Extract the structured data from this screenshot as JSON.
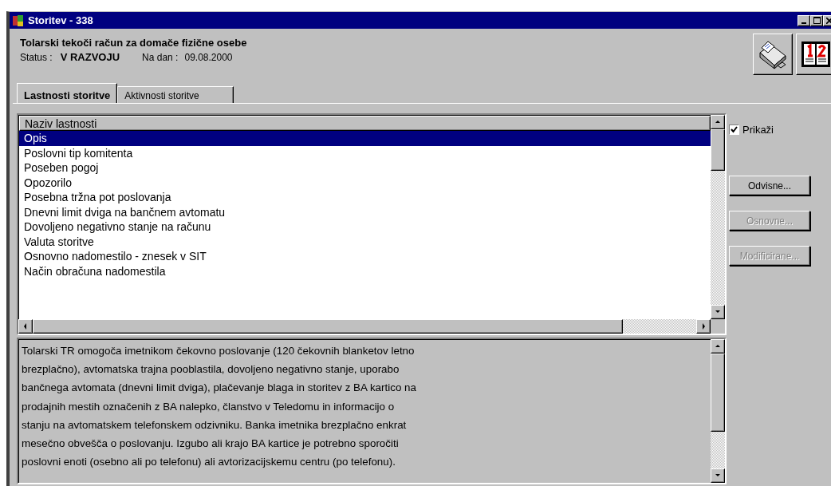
{
  "window": {
    "title": "Storitev - 338"
  },
  "header": {
    "service_name": "Tolarski tekoči račun za domače fizične osebe",
    "status_label": "Status :",
    "status_value": "V RAZVOJU",
    "date_label": "Na dan :",
    "date_value": "09.08.2000"
  },
  "tabs": [
    {
      "label": "Lastnosti storitve",
      "selected": true
    },
    {
      "label": "Aktivnosti storitve",
      "selected": false
    }
  ],
  "properties": {
    "column": "Naziv lastnosti",
    "rows": [
      {
        "label": "Opis",
        "selected": true
      },
      {
        "label": "Poslovni tip komitenta",
        "selected": false
      },
      {
        "label": "Poseben pogoj",
        "selected": false
      },
      {
        "label": "Opozorilo",
        "selected": false
      },
      {
        "label": "Posebna tržna pot poslovanja",
        "selected": false
      },
      {
        "label": "Dnevni limit dviga na bančnem avtomatu",
        "selected": false
      },
      {
        "label": "Dovoljeno negativno stanje na računu",
        "selected": false
      },
      {
        "label": "Valuta storitve",
        "selected": false
      },
      {
        "label": "Osnovno nadomestilo - znesek v SIT",
        "selected": false
      },
      {
        "label": "Način obračuna nadomestila",
        "selected": false
      }
    ]
  },
  "description": {
    "lines": [
      "Tolarski TR omogoča imetnikom čekovno poslovanje (120 čekovnih blanketov letno",
      "brezplačno), avtomatska trajna pooblastila, dovoljeno negativno stanje, uporabo",
      "bančnega avtomata (dnevni limit dviga), plačevanje blaga in storitev z BA kartico na",
      "prodajnih mestih označenih z BA nalepko, članstvo v Teledomu in informacijo o",
      "stanju na avtomatskem telefonskem odzivniku. Banka imetnika brezplačno enkrat",
      "mesečno obvešča o poslovanju. Izgubo ali krajo BA kartice je potrebno sporočiti",
      "poslovni enoti (osebno ali po telefonu) ali avtorizacijskemu centru (po telefonu)."
    ]
  },
  "show_checkbox": {
    "label": "Prikaži",
    "checked": true
  },
  "buttons": [
    {
      "label": "Odvisne...",
      "disabled": false
    },
    {
      "label": "Osnovne...",
      "disabled": true
    },
    {
      "label": "Modificirane...",
      "disabled": true
    }
  ]
}
